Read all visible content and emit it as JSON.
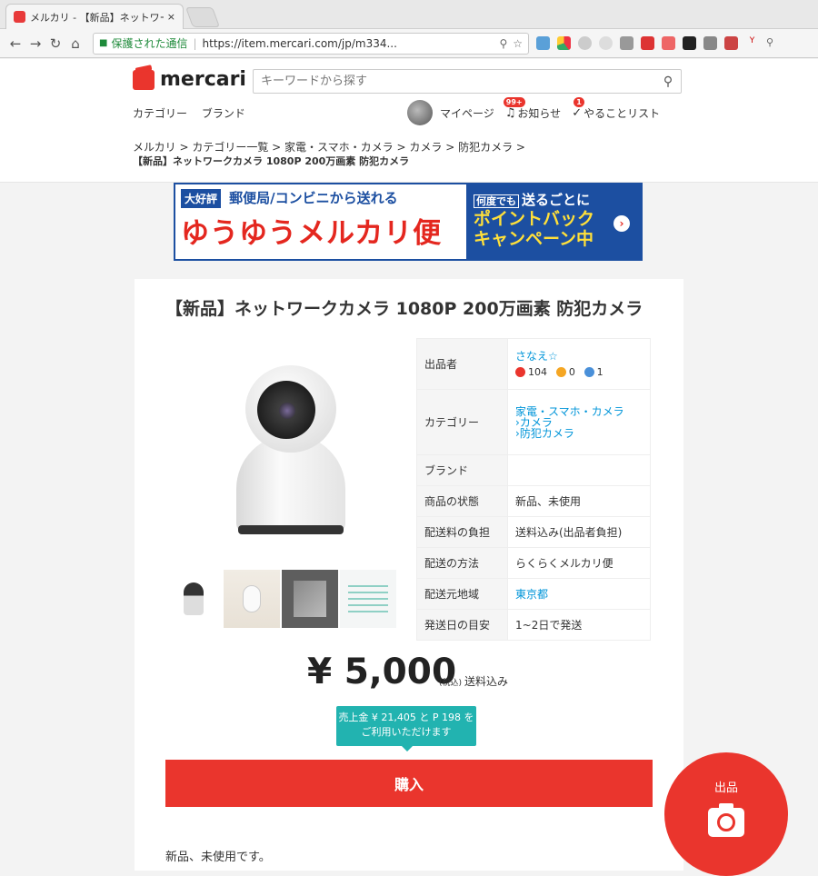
{
  "browser": {
    "tab_title": "メルカリ - 【新品】ネットワーク",
    "tab_close": "×",
    "secure_label": "保護された通信",
    "url": "https://item.mercari.com/jp/m334..."
  },
  "header": {
    "logo_text": "mercari",
    "search_placeholder": "キーワードから探す",
    "nav_category": "カテゴリー",
    "nav_brand": "ブランド",
    "mypage": "マイページ",
    "notifications": "お知らせ",
    "notifications_badge": "99+",
    "todo": "やることリスト",
    "todo_badge": "1"
  },
  "breadcrumb": {
    "items": [
      "メルカリ",
      "カテゴリー一覧",
      "家電・スマホ・カメラ",
      "カメラ",
      "防犯カメラ"
    ],
    "separator": " > ",
    "current": "【新品】ネットワークカメラ 1080P 200万画素 防犯カメラ"
  },
  "banner": {
    "tag": "大好評",
    "sub": "郵便局/コンビニから送れる",
    "big": "ゆうゆうメルカリ便",
    "r_tag": "何度でも",
    "r_line1": "送るごとに",
    "r_line2": "ポイントバック",
    "r_line3": "キャンペーン中"
  },
  "product": {
    "title": "【新品】ネットワークカメラ 1080P 200万画素 防犯カメラ",
    "info": {
      "seller_key": "出品者",
      "seller_name": "さなえ☆",
      "rate_good": "104",
      "rate_normal": "0",
      "rate_bad": "1",
      "category_key": "カテゴリー",
      "category_1": "家電・スマホ・カメラ",
      "category_2": "カメラ",
      "category_3": "防犯カメラ",
      "brand_key": "ブランド",
      "brand_val": "",
      "condition_key": "商品の状態",
      "condition_val": "新品、未使用",
      "shipping_fee_key": "配送料の負担",
      "shipping_fee_val": "送料込み(出品者負担)",
      "shipping_method_key": "配送の方法",
      "shipping_method_val": "らくらくメルカリ便",
      "ship_from_key": "配送元地域",
      "ship_from_val": "東京都",
      "ship_days_key": "発送日の目安",
      "ship_days_val": "1~2日で発送"
    },
    "price": "¥ 5,000",
    "tax": "(税込)",
    "shipping_included": "送料込み",
    "tip_line1": "売上金 ¥ 21,405 と P 198 を",
    "tip_line2": "ご利用いただけます",
    "buy_label": "購入",
    "description": "新品、未使用です。"
  },
  "sell_button": {
    "label": "出品"
  }
}
